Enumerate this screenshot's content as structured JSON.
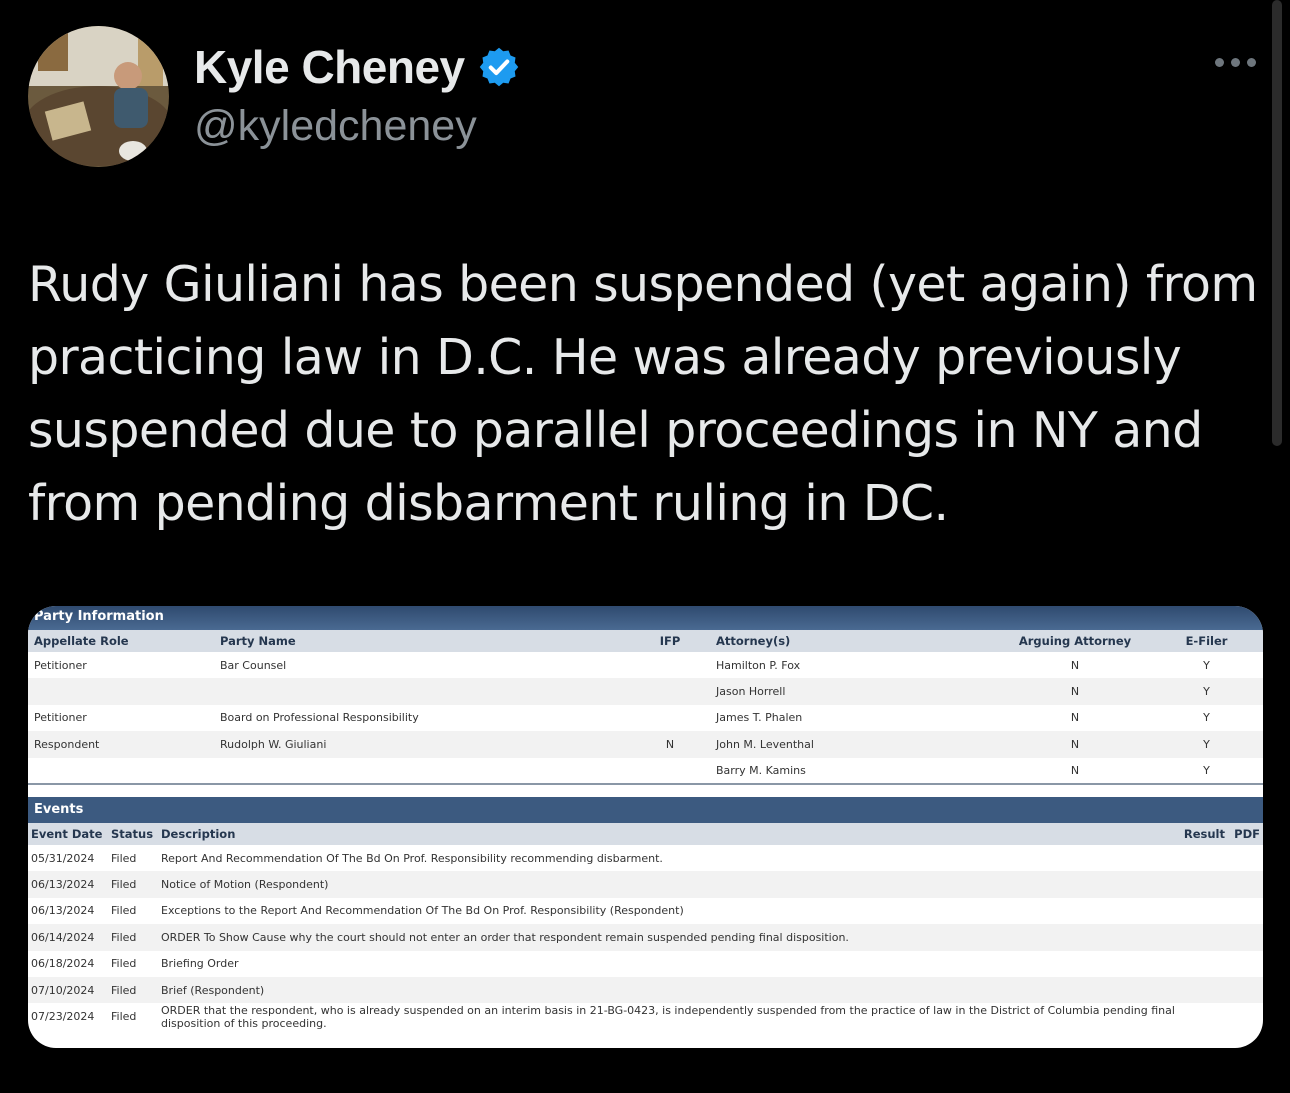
{
  "author": {
    "name": "Kyle Cheney",
    "handle": "@kyledcheney",
    "verified_color": "#1d9bf0"
  },
  "tweet": {
    "text": "Rudy Giuliani has been suspended (yet again) from practicing law in D.C. He was already previously suspended due to parallel proceedings in NY and from pending disbarment ruling in DC."
  },
  "docket": {
    "party_title": "Party Information",
    "party_headers": [
      "Appellate Role",
      "Party Name",
      "IFP",
      "Attorney(s)",
      "Arguing Attorney",
      "E-Filer"
    ],
    "party_rows": [
      [
        "Petitioner",
        "Bar Counsel",
        "",
        "Hamilton P. Fox",
        "N",
        "Y"
      ],
      [
        "",
        "",
        "",
        "Jason Horrell",
        "N",
        "Y"
      ],
      [
        "Petitioner",
        "Board on Professional Responsibility",
        "",
        "James T. Phalen",
        "N",
        "Y"
      ],
      [
        "Respondent",
        "Rudolph W. Giuliani",
        "N",
        "John M. Leventhal",
        "N",
        "Y"
      ],
      [
        "",
        "",
        "",
        "Barry M. Kamins",
        "N",
        "Y"
      ]
    ],
    "events_title": "Events",
    "events_headers": [
      "Event Date",
      "Status",
      "Description",
      "Result",
      "PDF"
    ],
    "events_rows": [
      [
        "05/31/2024",
        "Filed",
        "Report And Recommendation Of The Bd On Prof. Responsibility recommending disbarment."
      ],
      [
        "06/13/2024",
        "Filed",
        "Notice of Motion (Respondent)"
      ],
      [
        "06/13/2024",
        "Filed",
        "Exceptions to the Report And Recommendation Of The Bd On Prof. Responsibility (Respondent)"
      ],
      [
        "06/14/2024",
        "Filed",
        "ORDER To Show Cause why the court should not enter an order that respondent remain suspended pending final disposition."
      ],
      [
        "06/18/2024",
        "Filed",
        "Briefing Order"
      ],
      [
        "07/10/2024",
        "Filed",
        "Brief (Respondent)"
      ],
      [
        "07/23/2024",
        "Filed",
        "ORDER that the respondent, who is already suspended on an interim basis in 21-BG-0423, is independently suspended from the practice of law in the District of Columbia pending final disposition of this proceeding."
      ]
    ]
  }
}
